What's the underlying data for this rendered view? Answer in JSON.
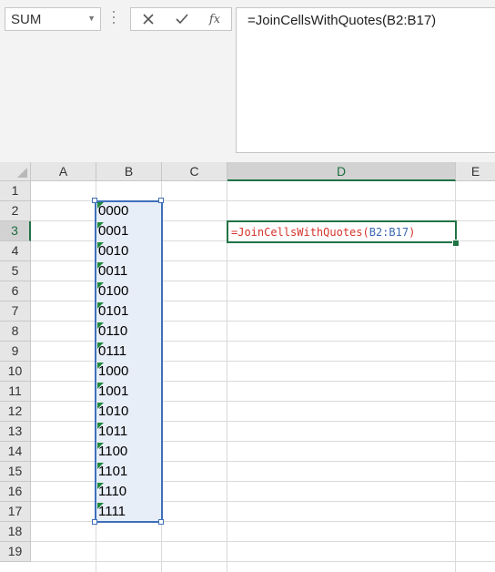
{
  "namebox": {
    "value": "SUM"
  },
  "formula_bar": {
    "cancel_icon": "x-icon",
    "enter_icon": "check-icon",
    "fx_label": "fx",
    "formula": "=JoinCellsWithQuotes(B2:B17)"
  },
  "columns": [
    "A",
    "B",
    "C",
    "D",
    "E"
  ],
  "rows": [
    "1",
    "2",
    "3",
    "4",
    "5",
    "6",
    "7",
    "8",
    "9",
    "10",
    "11",
    "12",
    "13",
    "14",
    "15",
    "16",
    "17",
    "18",
    "19"
  ],
  "column_b_values": [
    "0000",
    "0001",
    "0010",
    "0011",
    "0100",
    "0101",
    "0110",
    "0111",
    "1000",
    "1001",
    "1010",
    "1011",
    "1100",
    "1101",
    "1110",
    "1111"
  ],
  "active_cell": {
    "prefix": "=JoinCellsWithQuotes(",
    "range": "B2:B17",
    "suffix": ")"
  },
  "colors": {
    "accent_green": "#217346",
    "selection_blue": "#3e6fba",
    "formula_red": "#d4342c"
  }
}
